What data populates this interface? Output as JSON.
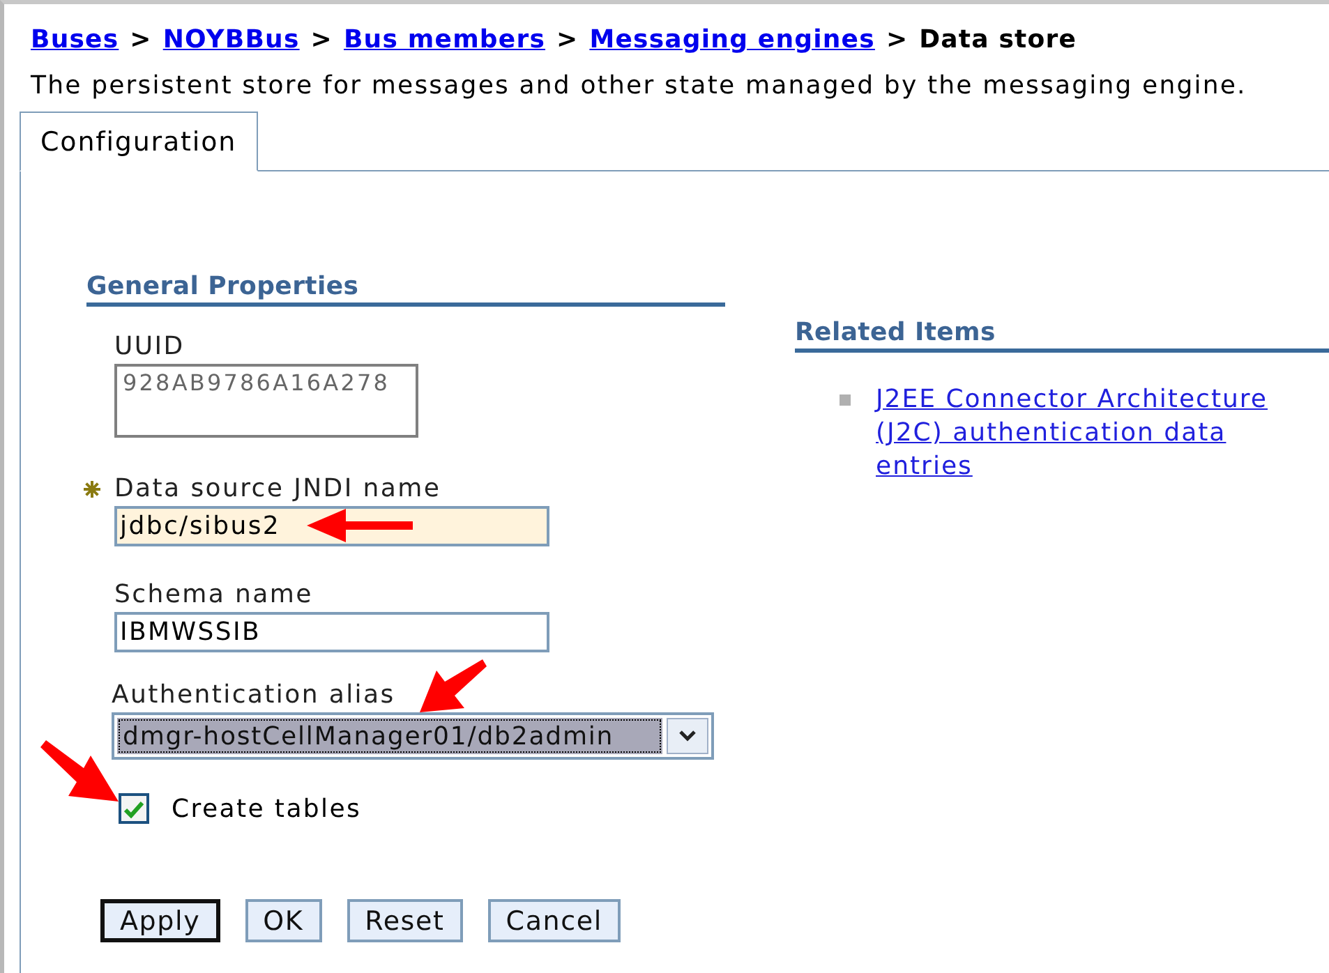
{
  "breadcrumb": {
    "separator": ">",
    "items": [
      {
        "label": "Buses",
        "link": true
      },
      {
        "label": "NOYBBus",
        "link": true
      },
      {
        "label": "Bus members",
        "link": true
      },
      {
        "label": "Messaging engines",
        "link": true
      },
      {
        "label": "Data store",
        "link": false
      }
    ]
  },
  "description": "The persistent store for messages and other state managed by the messaging engine.",
  "tabs": [
    {
      "label": "Configuration",
      "selected": true
    }
  ],
  "general_properties": {
    "title": "General Properties",
    "fields": [
      {
        "kind": "readonly",
        "label": "UUID",
        "value": "928AB9786A16A278"
      },
      {
        "kind": "text",
        "label": "Data source JNDI name",
        "required": true,
        "value": "jdbc/sibus2"
      },
      {
        "kind": "text",
        "label": "Schema name",
        "required": false,
        "value": "IBMWSSIB"
      },
      {
        "kind": "select",
        "label": "Authentication alias",
        "value": "dmgr-hostCellManager01/db2admin"
      },
      {
        "kind": "checkbox",
        "label": "Create tables",
        "checked": true
      }
    ]
  },
  "buttons": [
    {
      "label": "Apply",
      "default": true
    },
    {
      "label": "OK",
      "default": false
    },
    {
      "label": "Reset",
      "default": false
    },
    {
      "label": "Cancel",
      "default": false
    }
  ],
  "related_items": {
    "title": "Related Items",
    "links": [
      "J2EE Connector Architecture (J2C) authentication data entries"
    ]
  }
}
